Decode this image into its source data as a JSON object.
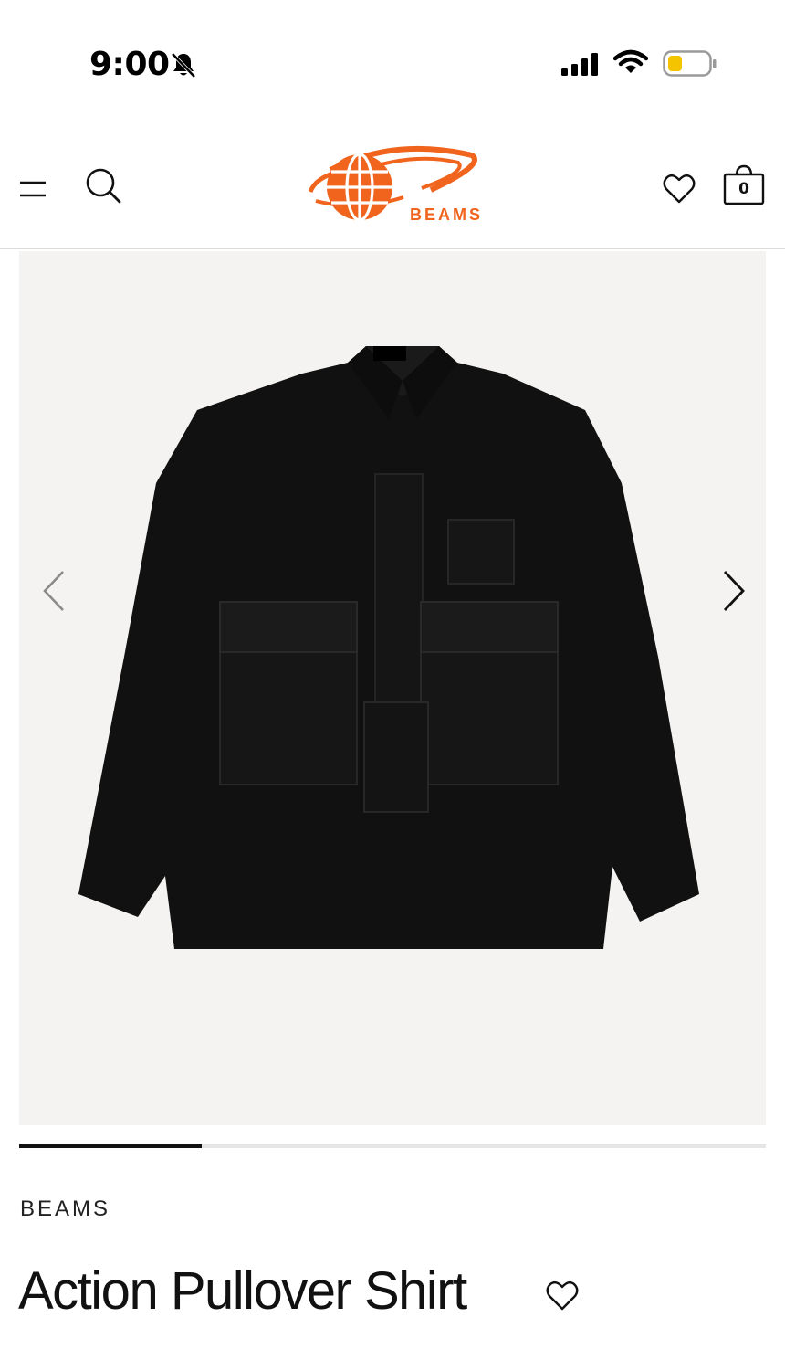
{
  "status_bar": {
    "time": "9:00",
    "icons": [
      "bell-slash-icon",
      "signal-icon",
      "wifi-icon",
      "battery-icon"
    ],
    "battery_color": "#f5c400"
  },
  "header": {
    "logo_text": "BEAMS",
    "logo_color": "#f0641e",
    "cart_count": "0",
    "icons": [
      "menu-icon",
      "search-icon",
      "heart-icon",
      "shopping-bag-icon"
    ]
  },
  "gallery": {
    "slides_fraction_viewed": 0.245,
    "icons": [
      "chevron-left-icon",
      "chevron-right-icon"
    ],
    "background_color": "#f4f3f1"
  },
  "product": {
    "brand": "BEAMS",
    "title": "Action Pullover Shirt"
  }
}
